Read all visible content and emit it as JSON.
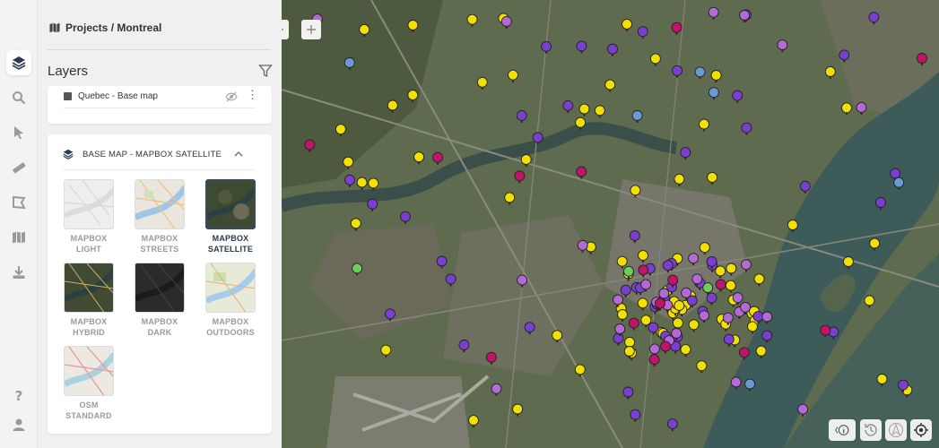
{
  "breadcrumb": "Projects / Montreal",
  "layers_title": "Layers",
  "top_layer": {
    "label": "Quebec - Base map",
    "visible": false
  },
  "basemap_section": {
    "title": "BASE MAP - MAPBOX SATELLITE",
    "expanded": true
  },
  "basemaps": [
    {
      "line1": "MAPBOX",
      "line2": "LIGHT",
      "selected": false,
      "style": "light"
    },
    {
      "line1": "MAPBOX",
      "line2": "STREETS",
      "selected": false,
      "style": "streets"
    },
    {
      "line1": "MAPBOX",
      "line2": "SATELLITE",
      "selected": true,
      "style": "satellite"
    },
    {
      "line1": "MAPBOX",
      "line2": "HYBRID",
      "selected": false,
      "style": "hybrid"
    },
    {
      "line1": "MAPBOX",
      "line2": "DARK",
      "selected": false,
      "style": "dark"
    },
    {
      "line1": "MAPBOX",
      "line2": "OUTDOORS",
      "selected": false,
      "style": "outdoors"
    },
    {
      "line1": "OSM",
      "line2": "STANDARD",
      "selected": false,
      "style": "osm"
    }
  ],
  "rail_icons": [
    "layers-icon",
    "search-icon",
    "pointer-icon",
    "ruler-icon",
    "polygon-icon",
    "map-icon",
    "download-icon",
    "help-icon",
    "user-icon"
  ],
  "map_tools": [
    "back-arrow-icon",
    "plus-icon"
  ],
  "map_controls": [
    "info-icon",
    "history-icon",
    "north-arrow-icon",
    "locate-icon"
  ],
  "marker_colors": {
    "yellow": "#f2e000",
    "purple": "#7a3fd0",
    "violet": "#b36ad6",
    "magenta": "#c0146a",
    "green": "#6ad05a",
    "blue": "#6a9ad6"
  },
  "marker_counts": {
    "yellow": 80,
    "purple": 55,
    "violet": 30,
    "magenta": 16,
    "green": 3,
    "blue": 6
  }
}
